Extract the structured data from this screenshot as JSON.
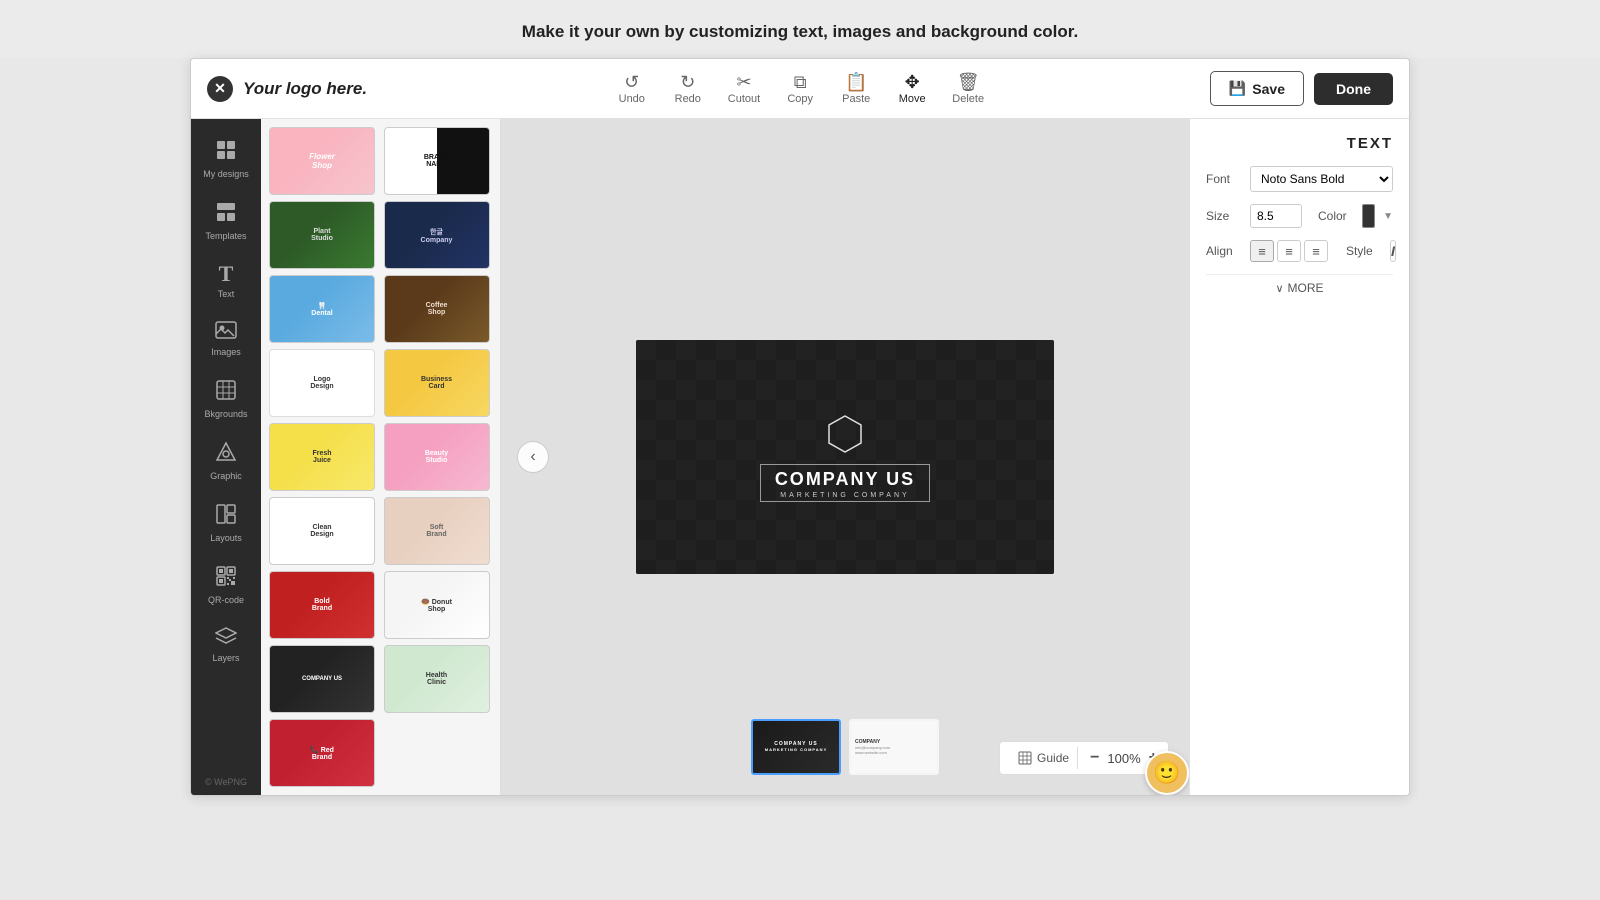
{
  "banner": {
    "text": "Make it your own by customizing text, images and background color."
  },
  "toolbar": {
    "logo_text": "Your logo here.",
    "undo_label": "Undo",
    "redo_label": "Redo",
    "cutout_label": "Cutout",
    "copy_label": "Copy",
    "paste_label": "Paste",
    "move_label": "Move",
    "delete_label": "Delete",
    "save_label": "Save",
    "done_label": "Done"
  },
  "sidebar": {
    "items": [
      {
        "id": "my-designs",
        "label": "My designs",
        "icon": "⊞"
      },
      {
        "id": "templates",
        "label": "Templates",
        "icon": "⊟"
      },
      {
        "id": "text",
        "label": "Text",
        "icon": "T"
      },
      {
        "id": "images",
        "label": "Images",
        "icon": "🖼"
      },
      {
        "id": "backgrounds",
        "label": "Bkgrounds",
        "icon": "▦"
      },
      {
        "id": "graphic",
        "label": "Graphic",
        "icon": "◈"
      },
      {
        "id": "layouts",
        "label": "Layouts",
        "icon": "⊞"
      },
      {
        "id": "qr-code",
        "label": "QR-code",
        "icon": "▣"
      },
      {
        "id": "layers",
        "label": "Layers",
        "icon": "⊕"
      }
    ],
    "footer": "© WePNG"
  },
  "canvas": {
    "company_name": "COMPANY US",
    "company_sub": "MARKETING COMPANY",
    "zoom": "100%",
    "guide_label": "Guide"
  },
  "text_panel": {
    "title": "TEXT",
    "font_label": "Font",
    "font_value": "Noto Sans Bold",
    "size_label": "Size",
    "size_value": "8.5",
    "color_label": "Color",
    "align_label": "Align",
    "style_label": "Style",
    "more_label": "MORE"
  },
  "thumbnails": [
    {
      "id": "thumb1",
      "active": true,
      "type": "dark"
    },
    {
      "id": "thumb2",
      "active": false,
      "type": "light"
    }
  ]
}
